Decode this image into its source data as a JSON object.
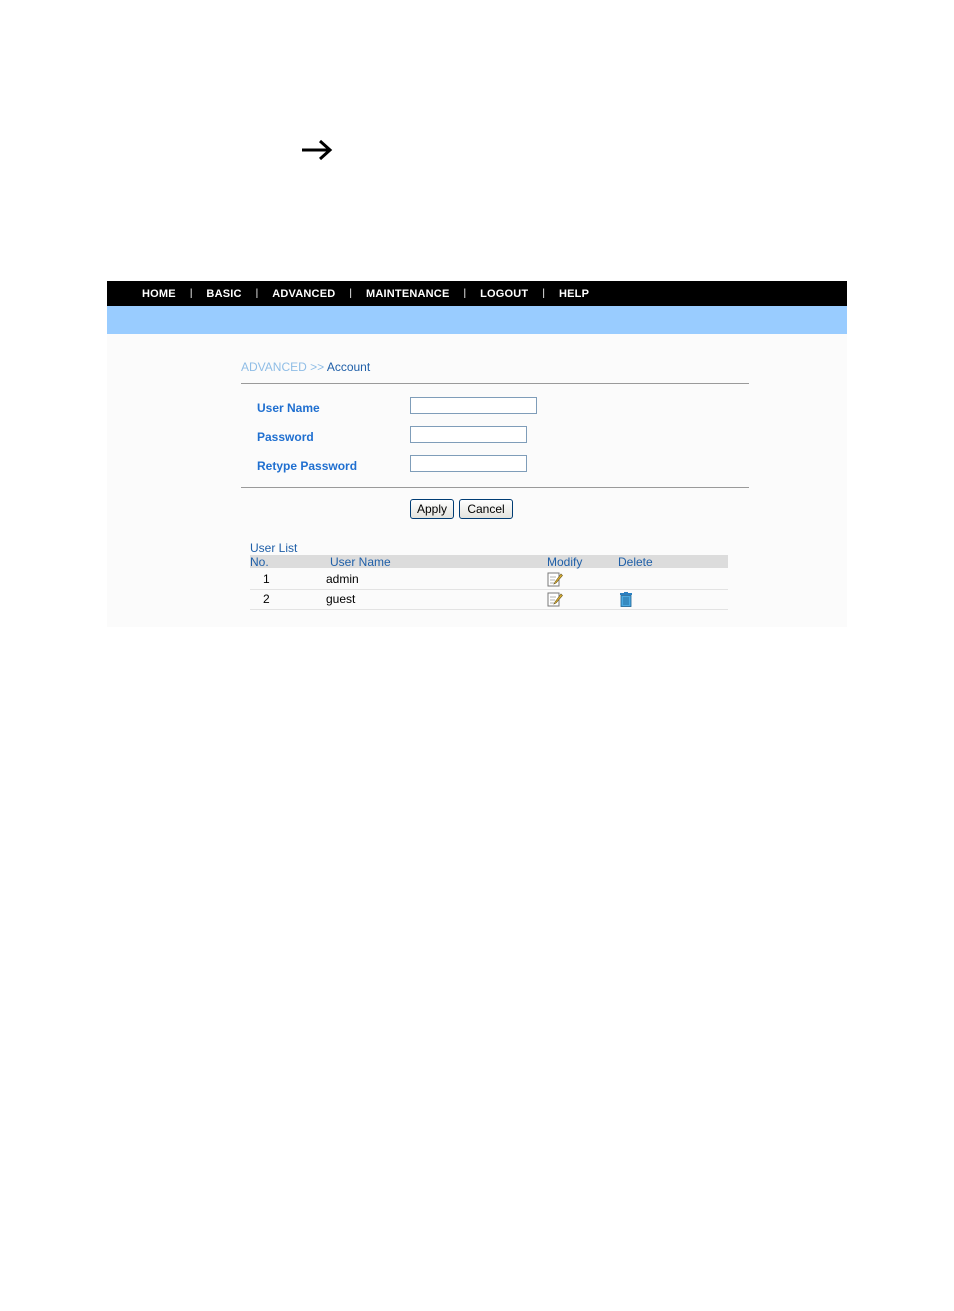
{
  "nav": {
    "items": [
      "HOME",
      "BASIC",
      "ADVANCED",
      "MAINTENANCE",
      "LOGOUT",
      "HELP"
    ],
    "separator": "|"
  },
  "breadcrumb": {
    "parent": "ADVANCED",
    "separator": ">>",
    "current": "Account"
  },
  "form": {
    "user_name_label": "User Name",
    "user_name_value": "",
    "password_label": "Password",
    "password_value": "",
    "retype_label": "Retype Password",
    "retype_value": "",
    "apply_label": "Apply",
    "cancel_label": "Cancel"
  },
  "user_list": {
    "title": "User List",
    "headers": {
      "no": "No.",
      "user_name": "User Name",
      "modify": "Modify",
      "delete": "Delete"
    },
    "rows": [
      {
        "no": "1",
        "user_name": "admin",
        "modify_icon": "edit-icon",
        "delete_icon": ""
      },
      {
        "no": "2",
        "user_name": "guest",
        "modify_icon": "edit-icon",
        "delete_icon": "trash-icon"
      }
    ]
  },
  "icons": {
    "top_arrow": "right-arrow-icon"
  },
  "colors": {
    "navbar_bg": "#000000",
    "subbar_bg": "#99ccff",
    "label_blue": "#1f6fd0",
    "header_gray": "#dcdcdc"
  }
}
